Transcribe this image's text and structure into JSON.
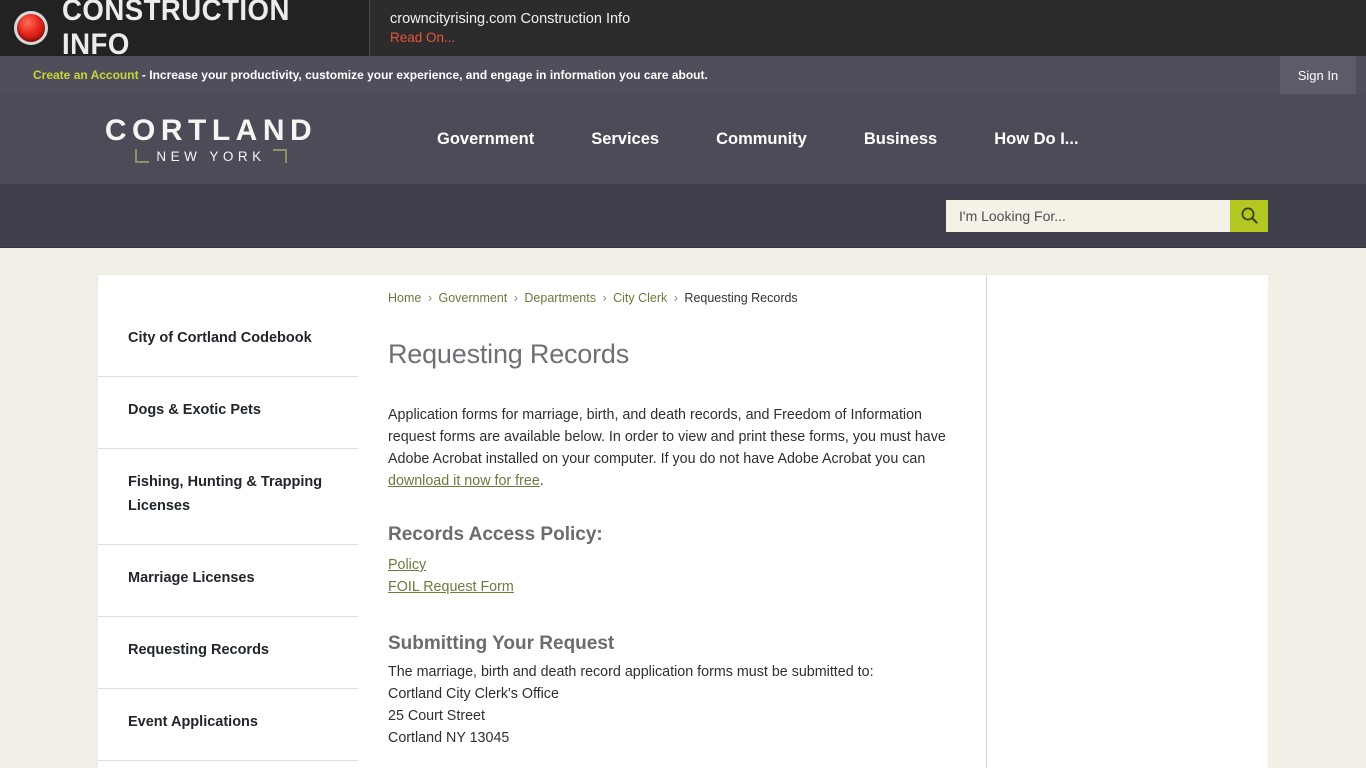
{
  "alert": {
    "badge_label": "CONSTRUCTION INFO",
    "dot_icon": "red-alert-dot-icon",
    "headline": "crowncityrising.com Construction Info",
    "read_on": "Read On..."
  },
  "account_bar": {
    "create_link": "Create an Account",
    "tagline": " - Increase your productivity, customize your experience, and engage in information you care about.",
    "sign_in": "Sign In"
  },
  "logo": {
    "main": "CORTLAND",
    "sub": "NEW YORK"
  },
  "mainnav": {
    "items": [
      {
        "label": "Government"
      },
      {
        "label": "Services"
      },
      {
        "label": "Community"
      },
      {
        "label": "Business"
      },
      {
        "label": "How Do I..."
      }
    ]
  },
  "search": {
    "placeholder": "I'm Looking For...",
    "value": "",
    "button_icon": "search-icon",
    "button_color": "#b2c721"
  },
  "breadcrumb": {
    "items": [
      {
        "label": "Home",
        "current": false
      },
      {
        "label": "Government",
        "current": false
      },
      {
        "label": "Departments",
        "current": false
      },
      {
        "label": "City Clerk",
        "current": false
      },
      {
        "label": "Requesting Records",
        "current": true
      }
    ],
    "separator": "›"
  },
  "sidebar": {
    "items": [
      {
        "label": "City of Cortland Codebook"
      },
      {
        "label": "Dogs & Exotic Pets"
      },
      {
        "label": "Fishing, Hunting & Trapping Licenses"
      },
      {
        "label": "Marriage Licenses"
      },
      {
        "label": "Requesting Records"
      },
      {
        "label": "Event Applications"
      }
    ]
  },
  "main": {
    "title": "Requesting Records",
    "intro_part1": "Application forms for marriage, birth, and death records, and Freedom of Information request forms are available below. In order to view and print these forms, you must have Adobe Acrobat installed on your computer. If you do not have Adobe Acrobat you can ",
    "intro_link": "download it now for free",
    "intro_part2": ".",
    "policy_heading": "Records Access Policy:",
    "policy_links": [
      {
        "label": "Policy"
      },
      {
        "label": "FOIL Request Form"
      }
    ],
    "submitting_heading": "Submitting Your Request",
    "submitting_intro": "The marriage, birth and death record application forms must be submitted to:",
    "address_lines": [
      "Cortland City Clerk's Office",
      "25 Court Street",
      "Cortland NY 13045"
    ]
  },
  "theme": {
    "accent_green": "#b2c721",
    "link_green": "#6d7a3e",
    "nav_bg": "#4b4c58",
    "search_bg": "#3f404b",
    "page_bg": "#f2efe6",
    "alert_bg": "#2c2c2c",
    "alert_red": "#e8533c"
  }
}
